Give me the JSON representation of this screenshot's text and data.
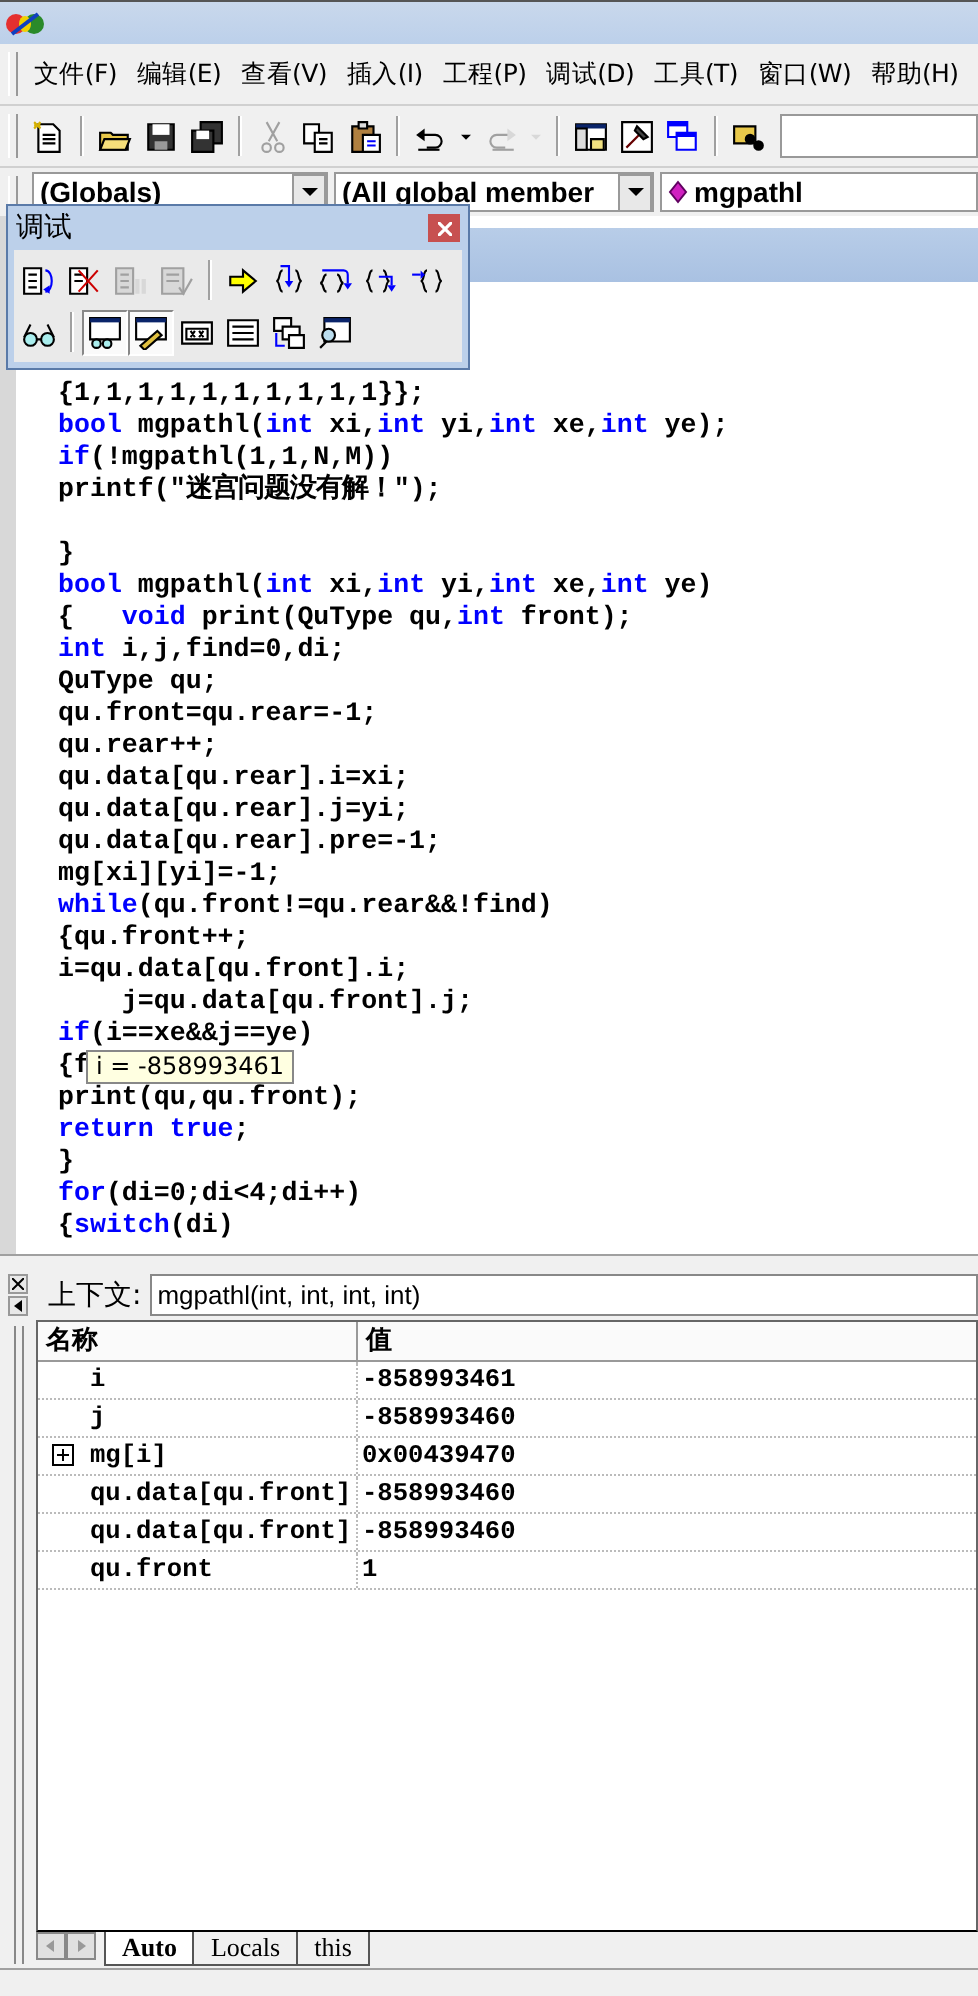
{
  "menu": [
    "文件(F)",
    "编辑(E)",
    "查看(V)",
    "插入(I)",
    "工程(P)",
    "调试(D)",
    "工具(T)",
    "窗口(W)",
    "帮助(H)"
  ],
  "toolbar": [
    {
      "kind": "new",
      "disabled": false
    },
    {
      "kind": "separator"
    },
    {
      "kind": "open",
      "disabled": false
    },
    {
      "kind": "save",
      "disabled": false
    },
    {
      "kind": "save-all",
      "disabled": false
    },
    {
      "kind": "separator"
    },
    {
      "kind": "cut",
      "disabled": true
    },
    {
      "kind": "copy",
      "disabled": false
    },
    {
      "kind": "paste",
      "disabled": false
    },
    {
      "kind": "separator"
    },
    {
      "kind": "undo",
      "disabled": false
    },
    {
      "kind": "caret",
      "disabled": false
    },
    {
      "kind": "redo",
      "disabled": true
    },
    {
      "kind": "caret",
      "disabled": true
    },
    {
      "kind": "separator"
    },
    {
      "kind": "workspace",
      "disabled": false
    },
    {
      "kind": "output",
      "disabled": false
    },
    {
      "kind": "windows",
      "disabled": false
    },
    {
      "kind": "separator"
    },
    {
      "kind": "find-in-files",
      "disabled": false
    }
  ],
  "combos": [
    {
      "value": "(Globals)"
    },
    {
      "value": "(All global member"
    },
    {
      "value": "mgpathl",
      "icon": true
    }
  ],
  "debug_toolbar": {
    "title": "调试",
    "rows": [
      [
        {
          "kind": "restart",
          "disabled": false,
          "pressed": false
        },
        {
          "kind": "stop",
          "disabled": false,
          "pressed": false
        },
        {
          "kind": "break",
          "disabled": true,
          "pressed": false
        },
        {
          "kind": "apply",
          "disabled": true,
          "pressed": false
        },
        {
          "kind": "separator"
        },
        {
          "kind": "next-statement",
          "disabled": false,
          "pressed": false
        },
        {
          "kind": "step-into",
          "disabled": false,
          "pressed": false
        },
        {
          "kind": "step-over",
          "disabled": false,
          "pressed": false
        },
        {
          "kind": "step-out",
          "disabled": false,
          "pressed": false
        },
        {
          "kind": "run-to-cursor",
          "disabled": false,
          "pressed": false
        }
      ],
      [
        {
          "kind": "quickwatch",
          "disabled": false,
          "pressed": false
        },
        {
          "kind": "separator"
        },
        {
          "kind": "watch",
          "disabled": false,
          "pressed": true
        },
        {
          "kind": "variables",
          "disabled": false,
          "pressed": true
        },
        {
          "kind": "registers",
          "disabled": false,
          "pressed": false
        },
        {
          "kind": "memory",
          "disabled": false,
          "pressed": false
        },
        {
          "kind": "call-stack",
          "disabled": false,
          "pressed": false
        },
        {
          "kind": "disassembly",
          "disabled": false,
          "pressed": false
        }
      ]
    ]
  },
  "code": [
    {
      "tokens": [
        {
          "t": "{1,1,1,1,1,1,1,1,1,1}};",
          "kind": "plain"
        }
      ]
    },
    {
      "tokens": [
        {
          "t": "bool",
          "kind": "keyword"
        },
        {
          "t": " mgpathl(",
          "kind": "plain"
        },
        {
          "t": "int",
          "kind": "keyword"
        },
        {
          "t": " xi,",
          "kind": "plain"
        },
        {
          "t": "int",
          "kind": "keyword"
        },
        {
          "t": " yi,",
          "kind": "plain"
        },
        {
          "t": "int",
          "kind": "keyword"
        },
        {
          "t": " xe,",
          "kind": "plain"
        },
        {
          "t": "int",
          "kind": "keyword"
        },
        {
          "t": " ye);",
          "kind": "plain"
        }
      ]
    },
    {
      "tokens": [
        {
          "t": "if",
          "kind": "keyword"
        },
        {
          "t": "(!mgpathl(1,1,N,M))",
          "kind": "plain"
        }
      ]
    },
    {
      "tokens": [
        {
          "t": "printf(\"迷宫问题没有解！\");",
          "kind": "plain"
        }
      ]
    },
    {
      "kind": "blank"
    },
    {
      "tokens": [
        {
          "t": "}",
          "kind": "plain"
        }
      ]
    },
    {
      "tokens": [
        {
          "t": "bool",
          "kind": "keyword"
        },
        {
          "t": " mgpathl(",
          "kind": "plain"
        },
        {
          "t": "int",
          "kind": "keyword"
        },
        {
          "t": " xi,",
          "kind": "plain"
        },
        {
          "t": "int",
          "kind": "keyword"
        },
        {
          "t": " yi,",
          "kind": "plain"
        },
        {
          "t": "int",
          "kind": "keyword"
        },
        {
          "t": " xe,",
          "kind": "plain"
        },
        {
          "t": "int",
          "kind": "keyword"
        },
        {
          "t": " ye)",
          "kind": "plain"
        }
      ]
    },
    {
      "tokens": [
        {
          "t": "{   ",
          "kind": "plain"
        },
        {
          "t": "void",
          "kind": "keyword"
        },
        {
          "t": " print(QuType qu,",
          "kind": "plain"
        },
        {
          "t": "int",
          "kind": "keyword"
        },
        {
          "t": " front);",
          "kind": "plain"
        }
      ]
    },
    {
      "tokens": [
        {
          "t": "int",
          "kind": "keyword"
        },
        {
          "t": " i,j,find=0,di;",
          "kind": "plain"
        }
      ]
    },
    {
      "tokens": [
        {
          "t": "QuType qu;",
          "kind": "plain"
        }
      ]
    },
    {
      "tokens": [
        {
          "t": "qu.front=qu.rear=-1;",
          "kind": "plain"
        }
      ]
    },
    {
      "tokens": [
        {
          "t": "qu.rear++;",
          "kind": "plain"
        }
      ]
    },
    {
      "tokens": [
        {
          "t": "qu.data[qu.rear].i=xi;",
          "kind": "plain"
        }
      ]
    },
    {
      "tokens": [
        {
          "t": "qu.data[qu.rear].j=yi;",
          "kind": "plain"
        }
      ]
    },
    {
      "tokens": [
        {
          "t": "qu.data[qu.rear].pre=-1;",
          "kind": "plain"
        }
      ]
    },
    {
      "tokens": [
        {
          "t": "mg[xi][yi]=-1;",
          "kind": "plain"
        }
      ]
    },
    {
      "tokens": [
        {
          "t": "while",
          "kind": "keyword"
        },
        {
          "t": "(qu.front!=qu.rear&&!find)",
          "kind": "plain"
        }
      ]
    },
    {
      "tokens": [
        {
          "t": "{qu.front++;",
          "kind": "plain"
        }
      ]
    },
    {
      "tokens": [
        {
          "t": "i=qu.data[qu.front].i;",
          "kind": "plain"
        }
      ]
    },
    {
      "tokens": [
        {
          "t": "    j=qu.data[qu.front].j;",
          "kind": "plain"
        }
      ]
    },
    {
      "tokens": [
        {
          "t": "if",
          "kind": "keyword"
        },
        {
          "t": "(i==xe&&j==ye)",
          "kind": "plain"
        }
      ]
    },
    {
      "tokens": [
        {
          "t": "{f",
          "kind": "plain"
        }
      ],
      "tooltip": "i = -858993461"
    },
    {
      "tokens": [
        {
          "t": "print(qu,qu.front);",
          "kind": "plain"
        }
      ]
    },
    {
      "tokens": [
        {
          "t": "return",
          "kind": "keyword"
        },
        {
          "t": " true",
          "kind": "keyword"
        },
        {
          "t": ";",
          "kind": "plain"
        }
      ]
    },
    {
      "tokens": [
        {
          "t": "}",
          "kind": "plain"
        }
      ]
    },
    {
      "tokens": [
        {
          "t": "for",
          "kind": "keyword"
        },
        {
          "t": "(di=0;di<4;di++)",
          "kind": "plain"
        }
      ]
    },
    {
      "tokens": [
        {
          "t": "{",
          "kind": "plain"
        },
        {
          "t": "switch",
          "kind": "keyword"
        },
        {
          "t": "(di)",
          "kind": "plain"
        }
      ]
    }
  ],
  "watch": {
    "context_label": "上下文:",
    "context": "mgpathl(int, int, int, int)",
    "columns": [
      "名称",
      "值"
    ],
    "rows": [
      {
        "name": "i",
        "value": "-858993461"
      },
      {
        "name": "j",
        "value": "-858993460"
      },
      {
        "name": "mg[i]",
        "value": "0x00439470",
        "expanded": false
      },
      {
        "name": "qu.data[qu.front]",
        "value": "-858993460"
      },
      {
        "name": "qu.data[qu.front]",
        "value": "-858993460"
      },
      {
        "name": "qu.front",
        "value": "1"
      }
    ],
    "tabs": [
      {
        "label": "Auto",
        "selected": true
      },
      {
        "label": "Locals",
        "selected": false
      },
      {
        "label": "this",
        "selected": false
      }
    ]
  }
}
